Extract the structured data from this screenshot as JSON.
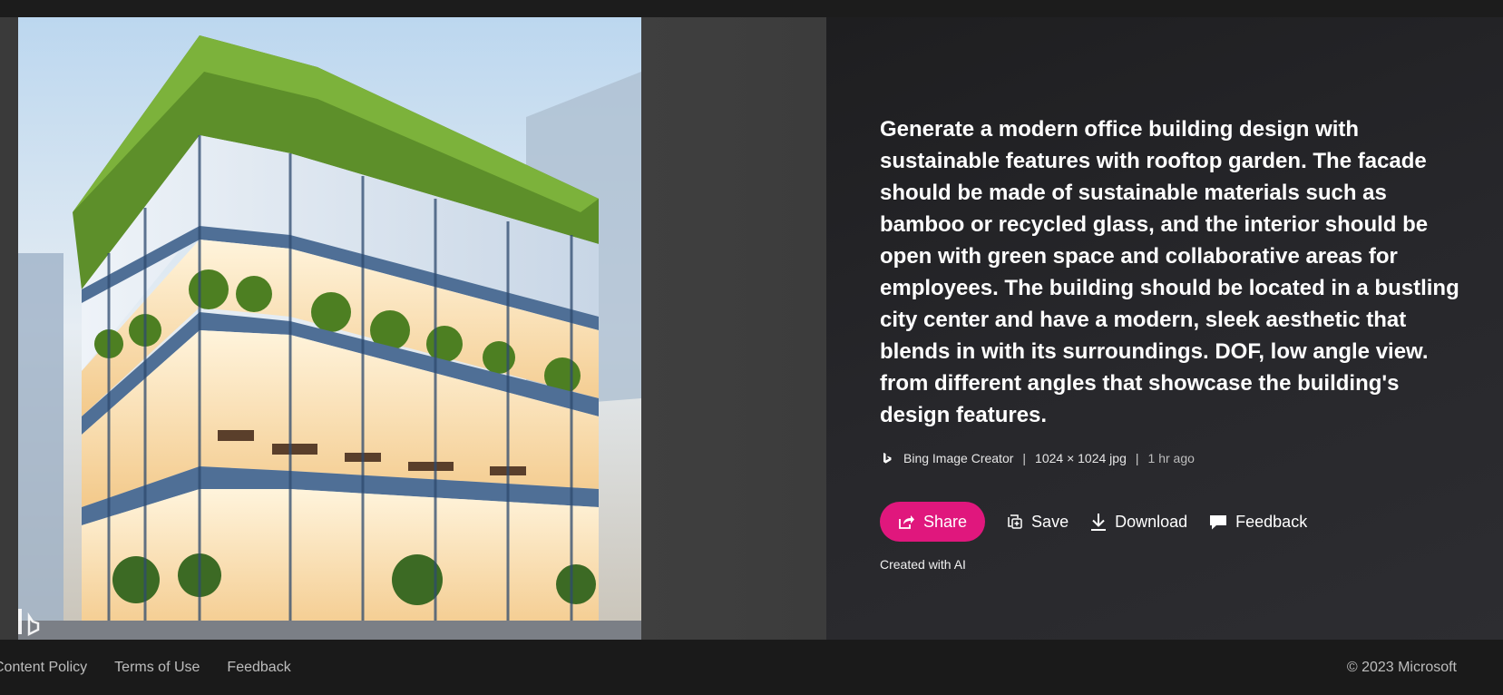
{
  "prompt": "Generate a modern office building design with sustainable features with rooftop garden. The facade should be made of sustainable materials such as bamboo or recycled glass, and the interior should be open with green space and collaborative areas for employees. The building should be located in a bustling city center and have a modern, sleek aesthetic that blends in with its surroundings. DOF, low angle view. from different angles that showcase the building's design features.",
  "meta": {
    "icon": "bing-logo-icon",
    "source": "Bing Image Creator",
    "separator": "|",
    "dimensions": "1024 × 1024 jpg",
    "time": "1 hr ago"
  },
  "actions": {
    "share": "Share",
    "save": "Save",
    "download": "Download",
    "feedback": "Feedback"
  },
  "ai_note": "Created with AI",
  "footer": {
    "links": [
      "Content Policy",
      "Terms of Use",
      "Feedback"
    ],
    "copyright": "© 2023 Microsoft"
  },
  "colors": {
    "accent": "#e0177d",
    "background": "#1b1b1b"
  }
}
